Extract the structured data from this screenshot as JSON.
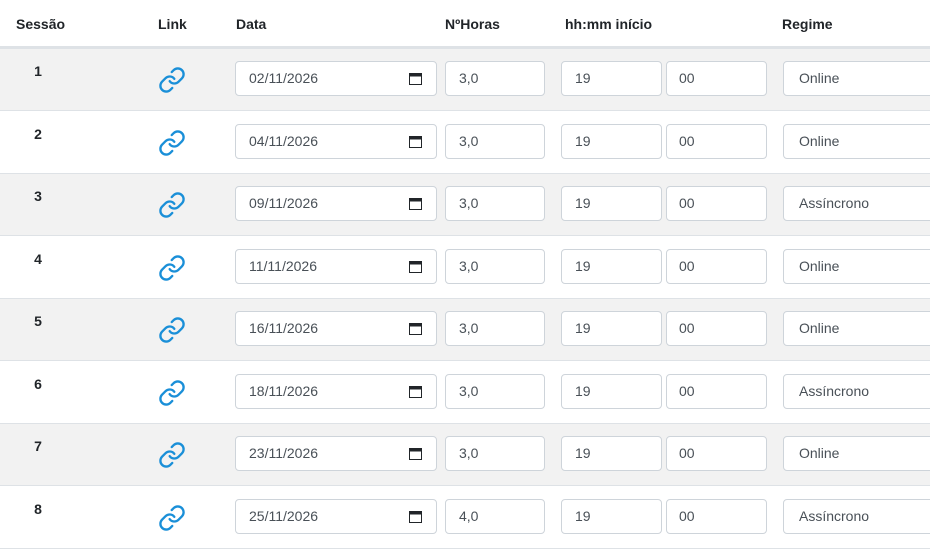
{
  "headers": {
    "sessao": "Sessão",
    "link": "Link",
    "data": "Data",
    "horas": "NºHoras",
    "inicio": "hh:mm início",
    "regime": "Regime"
  },
  "icons": {
    "link": "link-chain-icon",
    "calendar": "calendar-icon"
  },
  "colors": {
    "link_icon": "#1a8fd8",
    "row_shade": "#f2f2f2",
    "border": "#ced4da"
  },
  "rows": [
    {
      "sessao": "1",
      "data": "02/11/2026",
      "horas": "3,0",
      "hh": "19",
      "mm": "00",
      "regime": "Online"
    },
    {
      "sessao": "2",
      "data": "04/11/2026",
      "horas": "3,0",
      "hh": "19",
      "mm": "00",
      "regime": "Online"
    },
    {
      "sessao": "3",
      "data": "09/11/2026",
      "horas": "3,0",
      "hh": "19",
      "mm": "00",
      "regime": "Assíncrono"
    },
    {
      "sessao": "4",
      "data": "11/11/2026",
      "horas": "3,0",
      "hh": "19",
      "mm": "00",
      "regime": "Online"
    },
    {
      "sessao": "5",
      "data": "16/11/2026",
      "horas": "3,0",
      "hh": "19",
      "mm": "00",
      "regime": "Online"
    },
    {
      "sessao": "6",
      "data": "18/11/2026",
      "horas": "3,0",
      "hh": "19",
      "mm": "00",
      "regime": "Assíncrono"
    },
    {
      "sessao": "7",
      "data": "23/11/2026",
      "horas": "3,0",
      "hh": "19",
      "mm": "00",
      "regime": "Online"
    },
    {
      "sessao": "8",
      "data": "25/11/2026",
      "horas": "4,0",
      "hh": "19",
      "mm": "00",
      "regime": "Assíncrono"
    }
  ]
}
